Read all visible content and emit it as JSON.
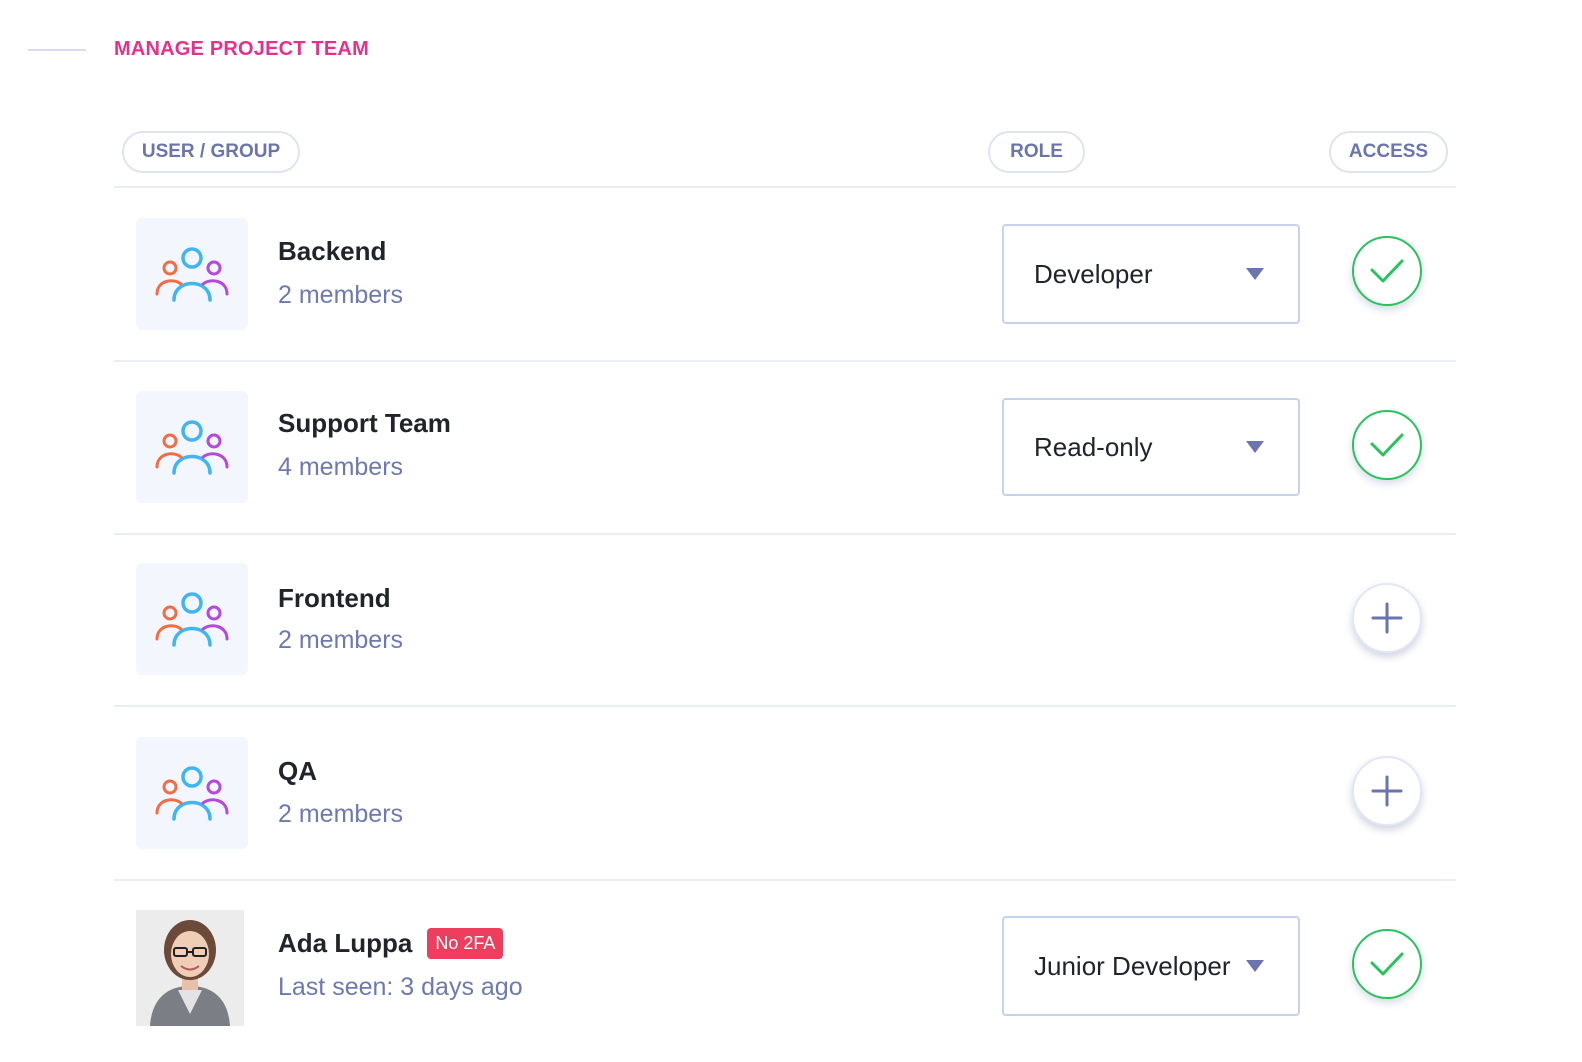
{
  "section": {
    "title": "MANAGE PROJECT TEAM"
  },
  "columns": {
    "user_group": "USER / GROUP",
    "role": "ROLE",
    "access": "ACCESS"
  },
  "colors": {
    "accent": "#e8308a",
    "muted": "#6e79b2",
    "success": "#27c45e",
    "danger": "#ee3e5e"
  },
  "rows": [
    {
      "name": "Backend",
      "subtitle": "2 members",
      "role": "Developer",
      "access": "granted",
      "icon": "group-icon"
    },
    {
      "name": "Support Team",
      "subtitle": "4 members",
      "role": "Read-only",
      "access": "granted",
      "icon": "group-icon"
    },
    {
      "name": "Frontend",
      "subtitle": "2 members",
      "role": "",
      "access": "add",
      "icon": "group-icon"
    },
    {
      "name": "QA",
      "subtitle": "2 members",
      "role": "",
      "access": "add",
      "icon": "group-icon"
    },
    {
      "name": "Ada Luppa",
      "badge": "No 2FA",
      "subtitle": "Last seen: 3 days ago",
      "role": "Junior Developer",
      "access": "granted",
      "icon": "user-photo"
    }
  ]
}
